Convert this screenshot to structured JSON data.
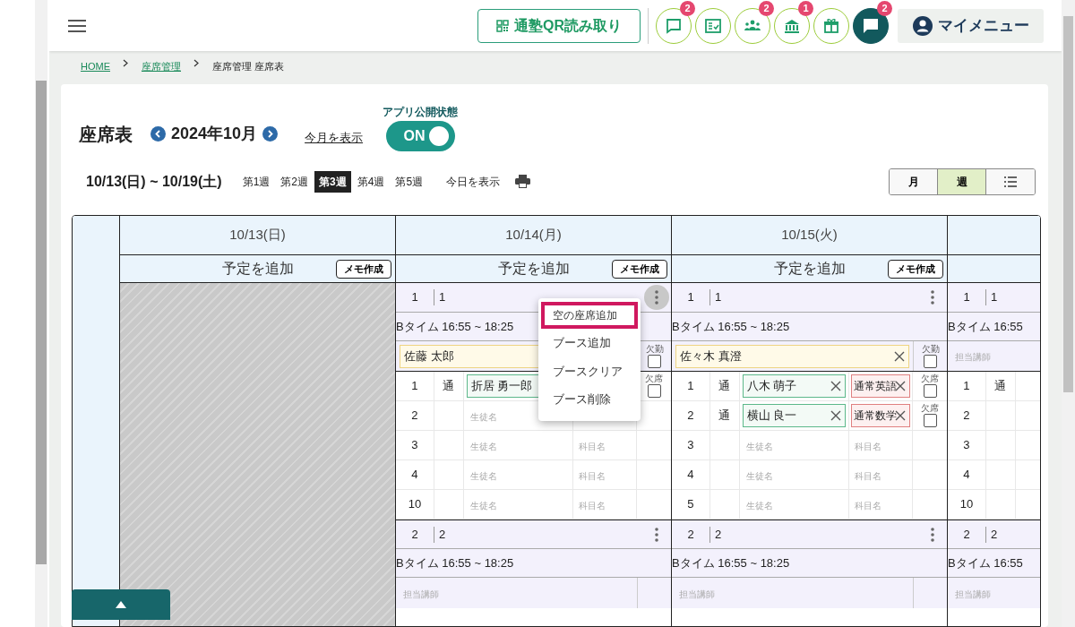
{
  "header": {
    "qr_button": "通塾QR読み取り",
    "icon_buttons": [
      {
        "kind": "chat",
        "badge": "2",
        "active": false
      },
      {
        "kind": "checklist",
        "active": false
      },
      {
        "kind": "people",
        "badge": "2",
        "active": false
      },
      {
        "kind": "building",
        "badge": "1",
        "active": false
      },
      {
        "kind": "gift",
        "active": false
      },
      {
        "kind": "chat",
        "badge": "2",
        "active": true
      }
    ],
    "my_menu": "マイメニュー"
  },
  "breadcrumb": [
    {
      "label": "HOME",
      "link": true
    },
    {
      "label": "座席管理",
      "link": true
    },
    {
      "label": "座席管理 座席表",
      "link": false
    }
  ],
  "page": {
    "title": "座席表",
    "month": "2024年10月",
    "show_this_month": "今月を表示",
    "app_status_label": "アプリ公開状態",
    "app_status": {
      "label": "ON",
      "on": true
    }
  },
  "week": {
    "range": "10/13(日) ~ 10/19(土)",
    "show_today": "今日を表示",
    "weeks": [
      {
        "label": "第1週",
        "selected": false
      },
      {
        "label": "第2週",
        "selected": false
      },
      {
        "label": "第3週",
        "selected": true
      },
      {
        "label": "第4週",
        "selected": false
      },
      {
        "label": "第5週",
        "selected": false
      }
    ]
  },
  "views": [
    {
      "kind": "text",
      "label": "月",
      "selected": false
    },
    {
      "kind": "text",
      "label": "週",
      "selected": true
    },
    {
      "kind": "list",
      "selected": false
    }
  ],
  "days": [
    {
      "date": "10/13(日)",
      "add_label": "予定を追加",
      "memo_button": "メモ作成",
      "closed": true
    },
    {
      "date": "10/14(月)",
      "add_label": "予定を追加",
      "memo_button": "メモ作成",
      "closed": false,
      "booths": [
        {
          "number": "1",
          "name": "1",
          "menu_button": true,
          "menu_open": true,
          "time": "Bタイム 16:55 ~ 18:25",
          "teacher": {
            "value": "佐藤 太郎",
            "clearable": false
          },
          "absent_label": "欠勤",
          "absent": false,
          "seats": [
            {
              "number": "1",
              "type": "通",
              "student": {
                "value": "折居 勇一郎",
                "clearable": false
              },
              "absent_label": "欠席",
              "absent": false
            },
            {
              "number": "2",
              "student": {
                "placeholder": "生徒名"
              }
            },
            {
              "number": "3",
              "student": {
                "placeholder": "生徒名"
              },
              "subject": {
                "placeholder": "科目名"
              }
            },
            {
              "number": "4",
              "student": {
                "placeholder": "生徒名"
              },
              "subject": {
                "placeholder": "科目名"
              }
            },
            {
              "number": "10",
              "student": {
                "placeholder": "生徒名"
              },
              "subject": {
                "placeholder": "科目名"
              }
            }
          ]
        },
        {
          "number": "2",
          "name": "2",
          "menu_button": true,
          "menu_open": false,
          "time": "Bタイム 16:55 ~ 18:25",
          "teacher": {
            "placeholder": "担当講師"
          }
        }
      ]
    },
    {
      "date": "10/15(火)",
      "add_label": "予定を追加",
      "memo_button": "メモ作成",
      "closed": false,
      "booths": [
        {
          "number": "1",
          "name": "1",
          "menu_button": true,
          "menu_open": false,
          "time": "Bタイム 16:55 ~ 18:25",
          "teacher": {
            "value": "佐々木 真澄",
            "clearable": true
          },
          "absent_label": "欠勤",
          "absent": false,
          "seats": [
            {
              "number": "1",
              "type": "通",
              "student": {
                "value": "八木 萌子",
                "clearable": true
              },
              "subject": {
                "value": "通常英語",
                "clearable": true
              },
              "absent_label": "欠席",
              "absent": false
            },
            {
              "number": "2",
              "type": "通",
              "student": {
                "value": "横山 良一",
                "clearable": true
              },
              "subject": {
                "value": "通常数学",
                "clearable": true
              },
              "absent_label": "欠席",
              "absent": false
            },
            {
              "number": "3",
              "student": {
                "placeholder": "生徒名"
              },
              "subject": {
                "placeholder": "科目名"
              }
            },
            {
              "number": "4",
              "student": {
                "placeholder": "生徒名"
              },
              "subject": {
                "placeholder": "科目名"
              }
            },
            {
              "number": "5",
              "student": {
                "placeholder": "生徒名"
              },
              "subject": {
                "placeholder": "科目名"
              }
            }
          ]
        },
        {
          "number": "2",
          "name": "2",
          "menu_button": true,
          "menu_open": false,
          "time": "Bタイム 16:55 ~ 18:25",
          "teacher": {
            "placeholder": "担当講師"
          }
        }
      ]
    },
    {
      "closed": false,
      "booths": [
        {
          "number": "1",
          "name": "1",
          "time": "Bタイム 16:55",
          "teacher": {
            "placeholder": "担当講師"
          },
          "seats": [
            {
              "number": "1",
              "type": "通"
            },
            {
              "number": "2"
            },
            {
              "number": "3"
            },
            {
              "number": "4"
            },
            {
              "number": "10"
            }
          ]
        },
        {
          "number": "2",
          "name": "2",
          "time": "Bタイム 16:55",
          "teacher": {
            "placeholder": "担当講師"
          }
        }
      ]
    }
  ],
  "context_menu": {
    "items": [
      {
        "label": "空の座席追加",
        "selected": true
      },
      {
        "label": "ブース追加",
        "selected": false
      },
      {
        "label": "ブースクリア",
        "selected": false
      },
      {
        "label": "ブース削除",
        "selected": false
      }
    ]
  }
}
